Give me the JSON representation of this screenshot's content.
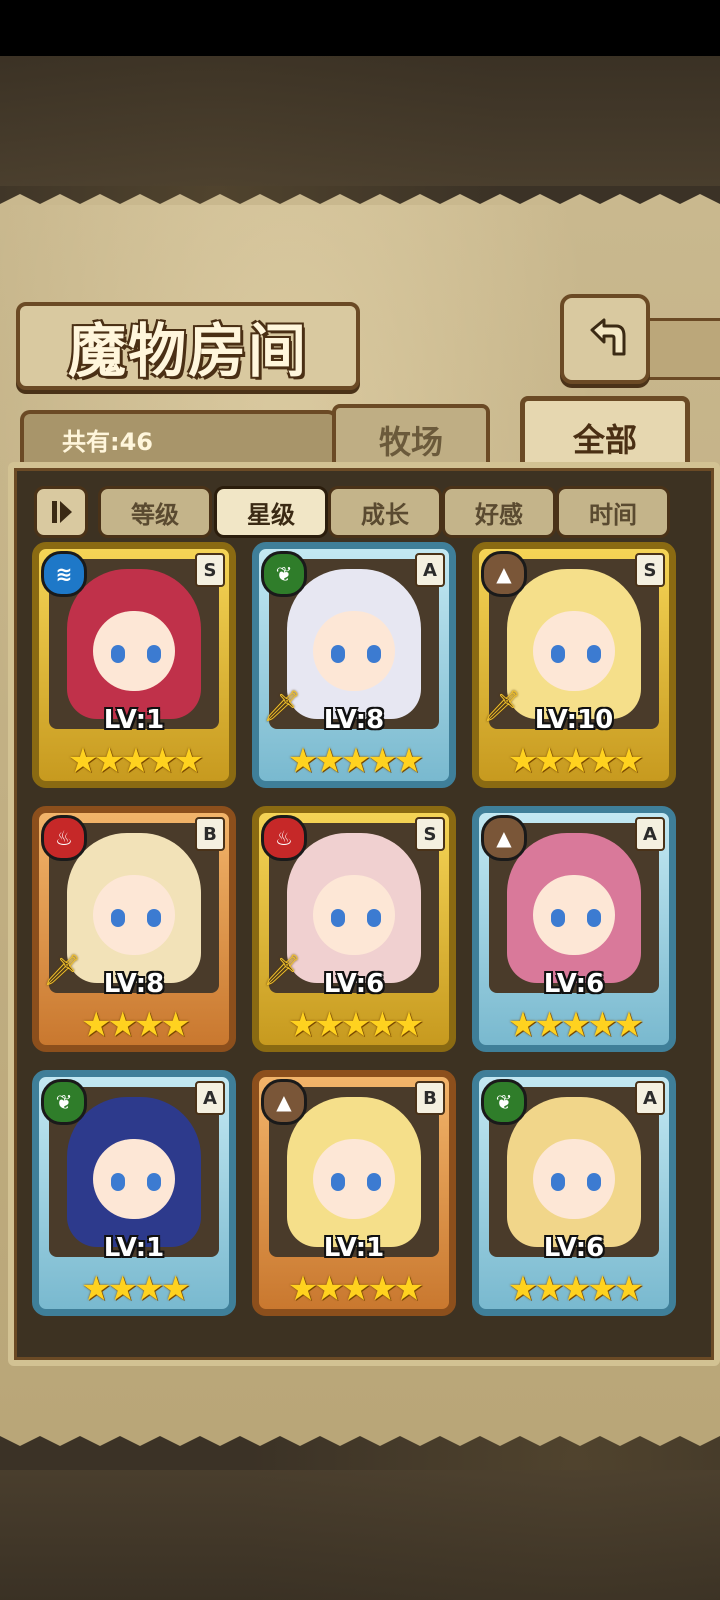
{
  "header": {
    "title": "魔物房间",
    "back_icon": "back-arrow-icon"
  },
  "tabs": {
    "count_label": "共有:46",
    "pasture": "牧场",
    "all": "全部",
    "selected": "全部"
  },
  "sort": {
    "toggle_icon": "sort-toggle-icon",
    "buttons": [
      "等级",
      "星级",
      "成长",
      "好感",
      "时间"
    ],
    "selected": "星级"
  },
  "cards": [
    {
      "element": "water",
      "rank": "S",
      "level": "LV:1",
      "stars": "★★★★★",
      "frame": "gold",
      "hair": "#c0314a",
      "weapon": false
    },
    {
      "element": "wood",
      "rank": "A",
      "level": "LV:8",
      "stars": "★★★★★",
      "frame": "blue",
      "hair": "#e7e7f2",
      "weapon": true
    },
    {
      "element": "earth",
      "rank": "S",
      "level": "LV:10",
      "stars": "★★★★★",
      "frame": "gold",
      "hair": "#f5df8a",
      "weapon": true
    },
    {
      "element": "fire",
      "rank": "B",
      "level": "LV:8",
      "stars": "★★★★",
      "frame": "orange",
      "hair": "#f2e2b8",
      "weapon": true
    },
    {
      "element": "fire",
      "rank": "S",
      "level": "LV:6",
      "stars": "★★★★★",
      "frame": "gold",
      "hair": "#f0d0d0",
      "weapon": true
    },
    {
      "element": "earth",
      "rank": "A",
      "level": "LV:6",
      "stars": "★★★★★",
      "frame": "blue",
      "hair": "#d9799a",
      "weapon": false
    },
    {
      "element": "wood",
      "rank": "A",
      "level": "LV:1",
      "stars": "★★★★",
      "frame": "blue",
      "hair": "#2d3a8c",
      "weapon": false
    },
    {
      "element": "earth",
      "rank": "B",
      "level": "LV:1",
      "stars": "★★★★★",
      "frame": "orange",
      "hair": "#f5df8a",
      "weapon": false
    },
    {
      "element": "wood",
      "rank": "A",
      "level": "LV:6",
      "stars": "★★★★★",
      "frame": "blue",
      "hair": "#f1d68a",
      "weapon": false
    }
  ],
  "colors": {
    "water": "#1e78c8",
    "wood": "#2f7d2a",
    "earth": "#7a5638",
    "fire": "#c62828"
  }
}
